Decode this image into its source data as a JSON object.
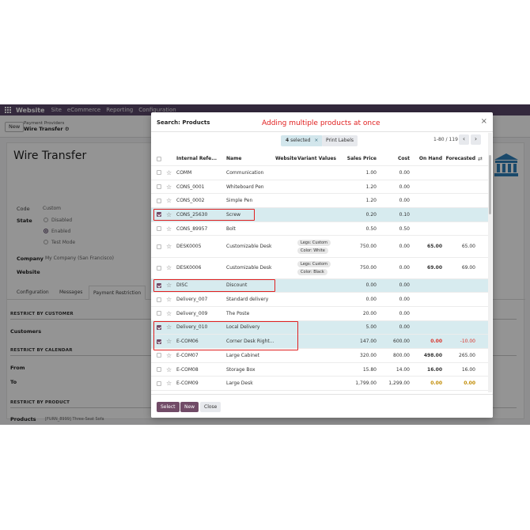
{
  "app": {
    "brand": "Website",
    "menus": [
      "Site",
      "eCommerce",
      "Reporting",
      "Configuration"
    ],
    "new_label": "New",
    "breadcrumb_parent": "Payment Providers",
    "breadcrumb_current": "Wire Transfer ⚙"
  },
  "form": {
    "title": "Wire Transfer",
    "code_label": "Code",
    "code_value": "Custom",
    "state_label": "State",
    "state_options": [
      "Disabled",
      "Enabled",
      "Test Mode"
    ],
    "company_label": "Company",
    "company_value": "My Company (San Francisco)",
    "website_label": "Website",
    "tabs": [
      "Configuration",
      "Messages",
      "Payment Restriction"
    ],
    "section_customer": "RESTRICT BY CUSTOMER",
    "customers_label": "Customers",
    "section_calendar": "RESTRICT BY CALENDAR",
    "from_label": "From",
    "to_label": "To",
    "section_product": "RESTRICT BY PRODUCT",
    "products_label": "Products",
    "products_value": "[FURN_8999] Three-Seat Sofa"
  },
  "modal": {
    "title": "Search: Products",
    "annotation": "Adding multiple products at once",
    "selected_count": "4",
    "selected_text": " selected",
    "clear_selection": "×",
    "print_labels": "Print Labels",
    "pager": "1-80 / 119",
    "prev": "‹",
    "next": "›",
    "close": "×",
    "columns": [
      "Internal Refe...",
      "Name",
      "Website",
      "Variant Values",
      "Sales Price",
      "Cost",
      "On Hand",
      "Forecasted"
    ],
    "rows": [
      {
        "ref": "COMM",
        "name": "Communication",
        "tags": [],
        "price": "1.00",
        "cost": "0.00",
        "onhand": "",
        "forecast": "",
        "selected": false
      },
      {
        "ref": "CONS_0001",
        "name": "Whiteboard Pen",
        "tags": [],
        "price": "1.20",
        "cost": "0.00",
        "onhand": "",
        "forecast": "",
        "selected": false
      },
      {
        "ref": "CONS_0002",
        "name": "Simple Pen",
        "tags": [],
        "price": "1.20",
        "cost": "0.00",
        "onhand": "",
        "forecast": "",
        "selected": false
      },
      {
        "ref": "CONS_25630",
        "name": "Screw",
        "tags": [],
        "price": "0.20",
        "cost": "0.10",
        "onhand": "",
        "forecast": "",
        "selected": true
      },
      {
        "ref": "CONS_89957",
        "name": "Bolt",
        "tags": [],
        "price": "0.50",
        "cost": "0.50",
        "onhand": "",
        "forecast": "",
        "selected": false
      },
      {
        "ref": "DESK0005",
        "name": "Customizable Desk",
        "tags": [
          "Legs: Custom",
          "Color: White"
        ],
        "price": "750.00",
        "cost": "0.00",
        "onhand": "65.00",
        "forecast": "65.00",
        "selected": false
      },
      {
        "ref": "DESK0006",
        "name": "Customizable Desk",
        "tags": [
          "Legs: Custom",
          "Color: Black"
        ],
        "price": "750.00",
        "cost": "0.00",
        "onhand": "69.00",
        "forecast": "69.00",
        "selected": false
      },
      {
        "ref": "DISC",
        "name": "Discount",
        "tags": [],
        "price": "0.00",
        "cost": "0.00",
        "onhand": "",
        "forecast": "",
        "selected": true
      },
      {
        "ref": "Delivery_007",
        "name": "Standard delivery",
        "tags": [],
        "price": "0.00",
        "cost": "0.00",
        "onhand": "",
        "forecast": "",
        "selected": false
      },
      {
        "ref": "Delivery_009",
        "name": "The Poste",
        "tags": [],
        "price": "20.00",
        "cost": "0.00",
        "onhand": "",
        "forecast": "",
        "selected": false
      },
      {
        "ref": "Delivery_010",
        "name": "Local Delivery",
        "tags": [],
        "price": "5.00",
        "cost": "0.00",
        "onhand": "",
        "forecast": "",
        "selected": true
      },
      {
        "ref": "E-COM06",
        "name": "Corner Desk Right...",
        "tags": [],
        "price": "147.00",
        "cost": "600.00",
        "onhand": "0.00",
        "forecast": "-10.00",
        "selected": true,
        "status": "red"
      },
      {
        "ref": "E-COM07",
        "name": "Large Cabinet",
        "tags": [],
        "price": "320.00",
        "cost": "800.00",
        "onhand": "498.00",
        "forecast": "265.00",
        "selected": false
      },
      {
        "ref": "E-COM08",
        "name": "Storage Box",
        "tags": [],
        "price": "15.80",
        "cost": "14.00",
        "onhand": "16.00",
        "forecast": "16.00",
        "selected": false
      },
      {
        "ref": "E-COM09",
        "name": "Large Desk",
        "tags": [],
        "price": "1,799.00",
        "cost": "1,299.00",
        "onhand": "0.00",
        "forecast": "0.00",
        "selected": false,
        "status": "yellow"
      }
    ],
    "footer": {
      "select": "Select",
      "new": "New",
      "close": "Close"
    }
  },
  "colors": {
    "primary": "#714b67",
    "navbar": "#5a4769",
    "selected_row": "#d7ebef",
    "annotation": "#e02020"
  }
}
